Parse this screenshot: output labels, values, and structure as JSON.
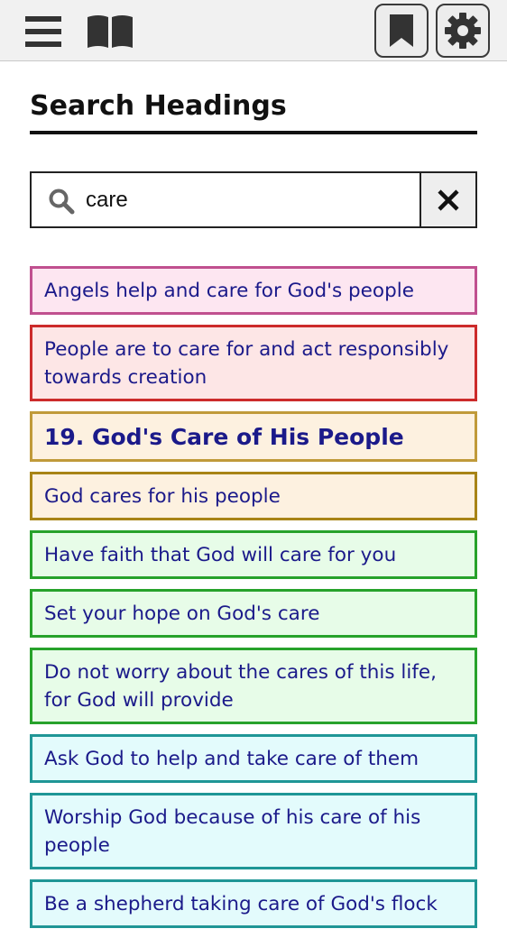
{
  "toolbar": {
    "menu_icon": "hamburger-menu-icon",
    "book_icon": "open-book-icon",
    "bookmark_icon": "bookmark-icon",
    "settings_icon": "gear-icon"
  },
  "page": {
    "title": "Search Headings"
  },
  "search": {
    "value": "care",
    "icon": "search-icon",
    "clear_label": "✕"
  },
  "results": [
    {
      "text": "Angels help and care for God's people",
      "border": "#c0508f",
      "bg": "#fde6f1"
    },
    {
      "text": "People are to care for and act responsibly towards creation",
      "border": "#cc2b2b",
      "bg": "#fde6e6"
    },
    {
      "text": "19. God's Care of His People",
      "border": "#c09a3a",
      "bg": "#fdf1e0",
      "heading": true
    },
    {
      "text": "God cares for his people",
      "border": "#a88416",
      "bg": "#fdf1e0"
    },
    {
      "text": "Have faith that God will care for you",
      "border": "#27a22b",
      "bg": "#e7fce8"
    },
    {
      "text": "Set your hope on God's care",
      "border": "#27a22b",
      "bg": "#e7fce8"
    },
    {
      "text": "Do not worry about the cares of this life, for God will provide",
      "border": "#27a22b",
      "bg": "#e7fce8"
    },
    {
      "text": "Ask God to help and take care of them",
      "border": "#1f9696",
      "bg": "#e3fbfc"
    },
    {
      "text": "Worship God because of his care of his people",
      "border": "#1f9696",
      "bg": "#e3fbfc"
    },
    {
      "text": "Be a shepherd taking care of God's flock",
      "border": "#1f9696",
      "bg": "#e3fbfc"
    }
  ]
}
